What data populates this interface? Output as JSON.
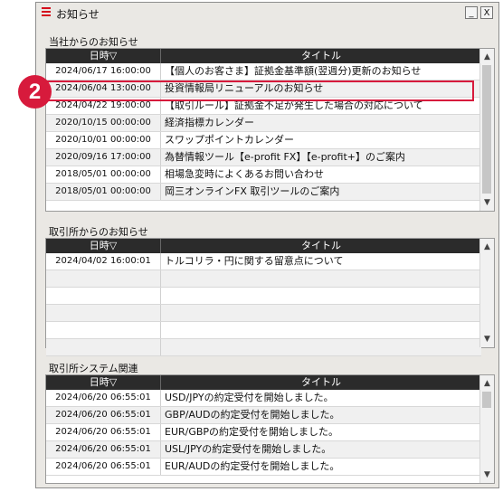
{
  "window": {
    "title": "お知らせ",
    "minimize": "_",
    "close": "X"
  },
  "sections": [
    {
      "label": "当社からのお知らせ",
      "headers": [
        "日時▽",
        "タイトル"
      ],
      "rows": [
        [
          "2024/06/17 16:00:00",
          "【個人のお客さま】証拠金基準額(翌週分)更新のお知らせ"
        ],
        [
          "2024/06/04 13:00:00",
          "投資情報局リニューアルのお知らせ"
        ],
        [
          "2024/04/22 19:00:00",
          "【取引ルール】証拠金不足が発生した場合の対応について"
        ],
        [
          "2020/10/15 00:00:00",
          "経済指標カレンダー"
        ],
        [
          "2020/10/01 00:00:00",
          "スワップポイントカレンダー"
        ],
        [
          "2020/09/16 17:00:00",
          "為替情報ツール【e-profit FX】【e-profit+】のご案内"
        ],
        [
          "2018/05/01 00:00:00",
          "相場急変時によくあるお問い合わせ"
        ],
        [
          "2018/05/01 00:00:00",
          "岡三オンラインFX 取引ツールのご案内"
        ]
      ]
    },
    {
      "label": "取引所からのお知らせ",
      "headers": [
        "日時▽",
        "タイトル"
      ],
      "rows": [
        [
          "2024/04/02 16:00:01",
          "トルコリラ・円に関する留意点について"
        ],
        [
          "",
          ""
        ],
        [
          "",
          ""
        ],
        [
          "",
          ""
        ],
        [
          "",
          ""
        ],
        [
          "",
          ""
        ]
      ]
    },
    {
      "label": "取引所システム関連",
      "headers": [
        "日時▽",
        "タイトル"
      ],
      "rows": [
        [
          "2024/06/20 06:55:01",
          "USD/JPYの約定受付を開始しました。"
        ],
        [
          "2024/06/20 06:55:01",
          "GBP/AUDの約定受付を開始しました。"
        ],
        [
          "2024/06/20 06:55:01",
          "EUR/GBPの約定受付を開始しました。"
        ],
        [
          "2024/06/20 06:55:01",
          "USL/JPYの約定受付を開始しました。"
        ],
        [
          "2024/06/20 06:55:01",
          "EUR/AUDの約定受付を開始しました。"
        ]
      ]
    }
  ],
  "callout": {
    "number": "2",
    "color": "#d71a3c"
  }
}
